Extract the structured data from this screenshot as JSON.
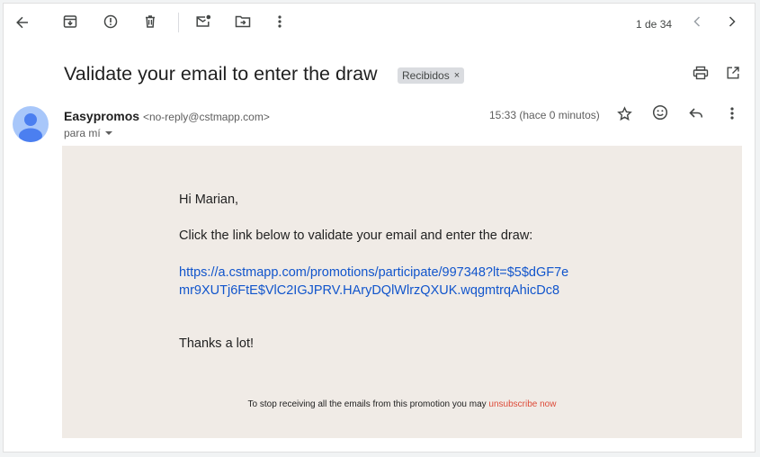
{
  "toolbar": {
    "back": "arrow-left-icon",
    "archive": "archive-icon",
    "spam": "report-spam-icon",
    "delete": "trash-icon",
    "mark_unread": "mark-unread-icon",
    "move": "move-to-folder-icon",
    "more": "more-vert-icon",
    "pager": "1 de 34",
    "prev": "chevron-left-icon",
    "next": "chevron-right-icon"
  },
  "email": {
    "subject": "Validate your email to enter the draw",
    "label": "Recibidos",
    "label_remove": "×",
    "sender_name": "Easypromos",
    "sender_address": "<no-reply@cstmapp.com>",
    "to": "para mí",
    "time": "15:33 (hace 0 minutos)",
    "body": {
      "greeting": "Hi Marian,",
      "instruction": "Click the link below to validate your email and enter the draw:",
      "link": "https://a.cstmapp.com/promotions/participate/997348?lt=$5$dGF7emr9XUTj6FtE$VlC2IGJPRV.HAryDQlWlrzQXUK.wqgmtrqAhicDc8",
      "thanks": "Thanks a lot!",
      "footer_text": "To stop receiving all the emails from this promotion you may ",
      "unsubscribe": "unsubscribe now"
    }
  },
  "colors": {
    "body_background": "#f0ebe6",
    "link": "#1155cc",
    "unsubscribe": "#dd4b39",
    "avatar": "#a8c7fa"
  }
}
